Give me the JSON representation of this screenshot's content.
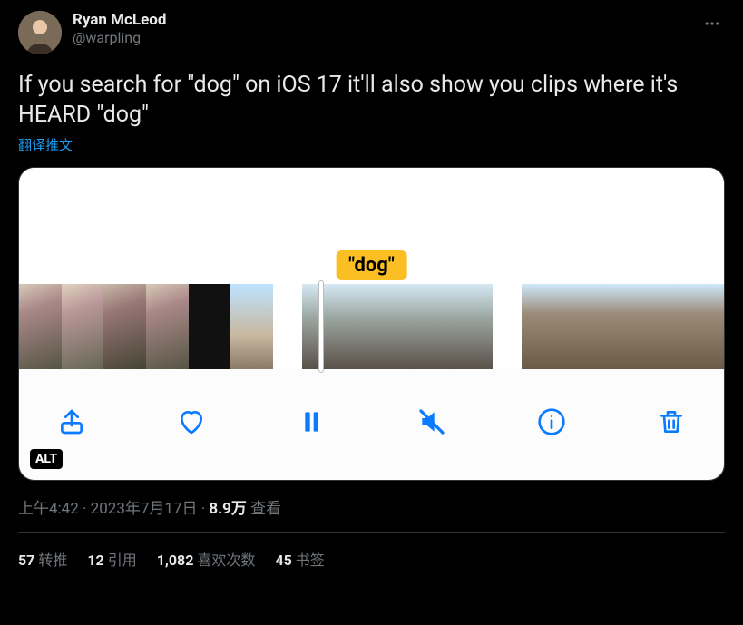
{
  "author": {
    "display_name": "Ryan McLeod",
    "handle": "@warpling"
  },
  "body": "If you search for \"dog\" on iOS 17 it'll also show you clips where it's HEARD \"dog\"",
  "translate_label": "翻译推文",
  "media": {
    "tag_text": "\"dog\"",
    "alt_badge": "ALT"
  },
  "meta": {
    "time": "上午4:42",
    "date": "2023年7月17日",
    "views_count": "8.9万",
    "views_label": "查看",
    "separator": " · "
  },
  "stats": {
    "retweets_count": "57",
    "retweets_label": "转推",
    "quotes_count": "12",
    "quotes_label": "引用",
    "likes_count": "1,082",
    "likes_label": "喜欢次数",
    "bookmarks_count": "45",
    "bookmarks_label": "书签"
  }
}
